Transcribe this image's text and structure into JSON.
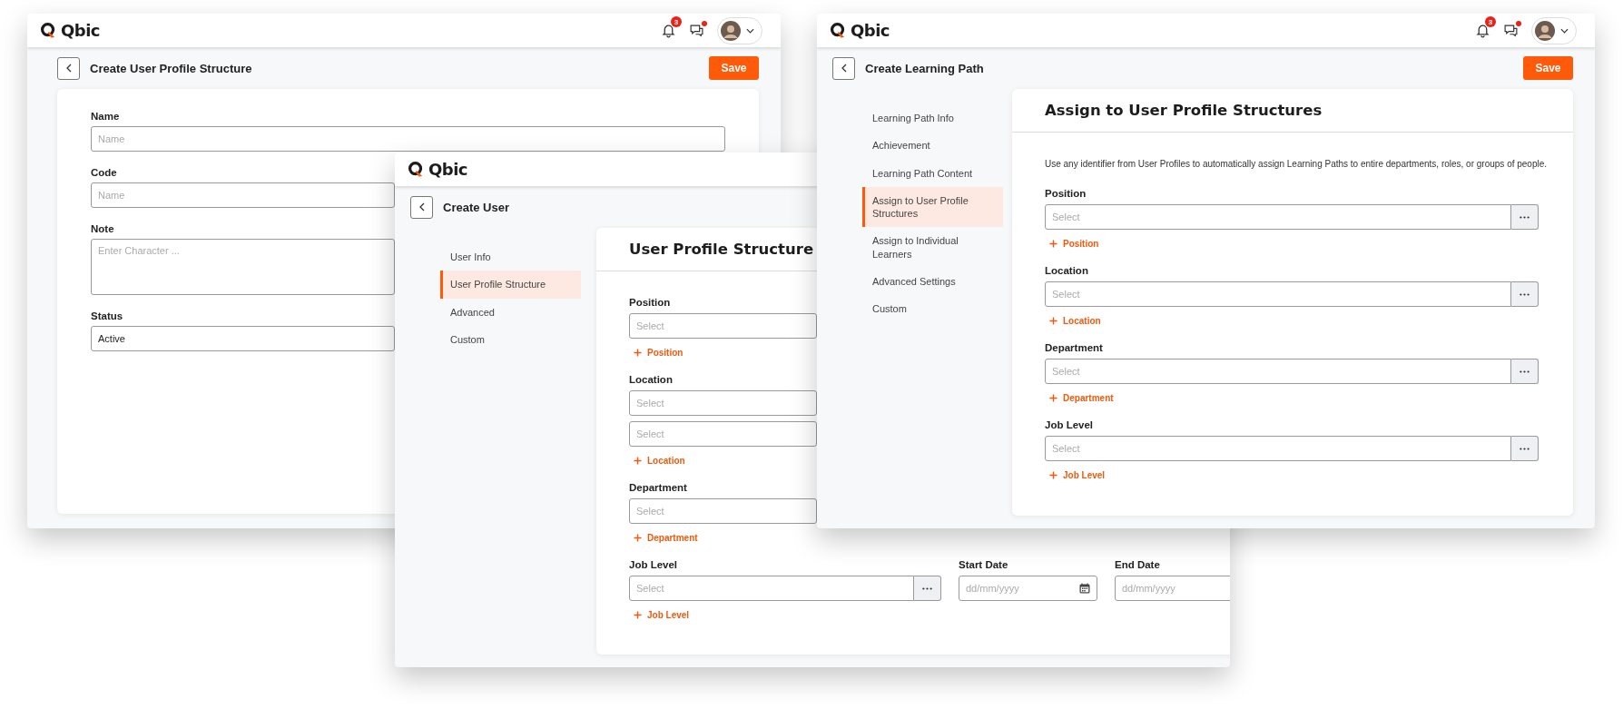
{
  "windows": [
    {
      "kind": "form",
      "logo": "Qbic",
      "notifications": "3",
      "messages_unread": true,
      "title": "Create User Profile Structure",
      "save": "Save",
      "fields": [
        {
          "kind": "input",
          "label": "Name",
          "placeholder": "Name"
        },
        {
          "kind": "input",
          "label": "Code",
          "placeholder": "Name"
        },
        {
          "kind": "textarea",
          "label": "Note",
          "placeholder": "Enter Character ..."
        },
        {
          "kind": "select",
          "label": "Status",
          "value": "Active"
        }
      ]
    },
    {
      "kind": "sections",
      "logo": "Qbic",
      "title": "Create User",
      "nav": [
        {
          "label": "User Info",
          "selected": false
        },
        {
          "label": "User Profile Structure",
          "selected": true
        },
        {
          "label": "Advanced",
          "selected": false
        },
        {
          "label": "Custom",
          "selected": false
        }
      ],
      "heading": "User Profile Structure",
      "groups": [
        {
          "label": "Position",
          "selects": [
            "Select"
          ],
          "more": false,
          "add": "Position"
        },
        {
          "label": "Location",
          "selects": [
            "Select",
            "Select"
          ],
          "more": false,
          "add": "Location"
        },
        {
          "label": "Department",
          "selects": [
            "Select"
          ],
          "more": false,
          "add": "Department"
        },
        {
          "label": "Job Level",
          "selects": [
            "Select"
          ],
          "more": true,
          "add": "Job Level",
          "dates": [
            {
              "label": "Start Date",
              "placeholder": "dd/mm/yyyy",
              "calendar": true
            },
            {
              "label": "End Date",
              "placeholder": "dd/mm/yyyy"
            }
          ]
        }
      ]
    },
    {
      "kind": "sections",
      "logo": "Qbic",
      "notifications": "3",
      "messages_unread": true,
      "title": "Create Learning Path",
      "save": "Save",
      "nav": [
        {
          "label": "Learning Path Info",
          "selected": false
        },
        {
          "label": "Achievement",
          "selected": false
        },
        {
          "label": "Learning Path Content",
          "selected": false
        },
        {
          "label": "Assign to User Profile Structures",
          "selected": true
        },
        {
          "label": "Assign to Individual Learners",
          "selected": false
        },
        {
          "label": "Advanced Settings",
          "selected": false
        },
        {
          "label": "Custom",
          "selected": false
        }
      ],
      "heading": "Assign to User Profile Structures",
      "description": "Use any identifier from User Profiles to automatically assign Learning Paths to entire departments, roles, or groups of people.",
      "groups": [
        {
          "label": "Position",
          "selects": [
            "Select"
          ],
          "more": true,
          "add": "Position"
        },
        {
          "label": "Location",
          "selects": [
            "Select"
          ],
          "more": true,
          "add": "Location"
        },
        {
          "label": "Department",
          "selects": [
            "Select"
          ],
          "more": true,
          "add": "Department"
        },
        {
          "label": "Job Level",
          "selects": [
            "Select"
          ],
          "more": true,
          "add": "Job Level"
        }
      ]
    }
  ]
}
